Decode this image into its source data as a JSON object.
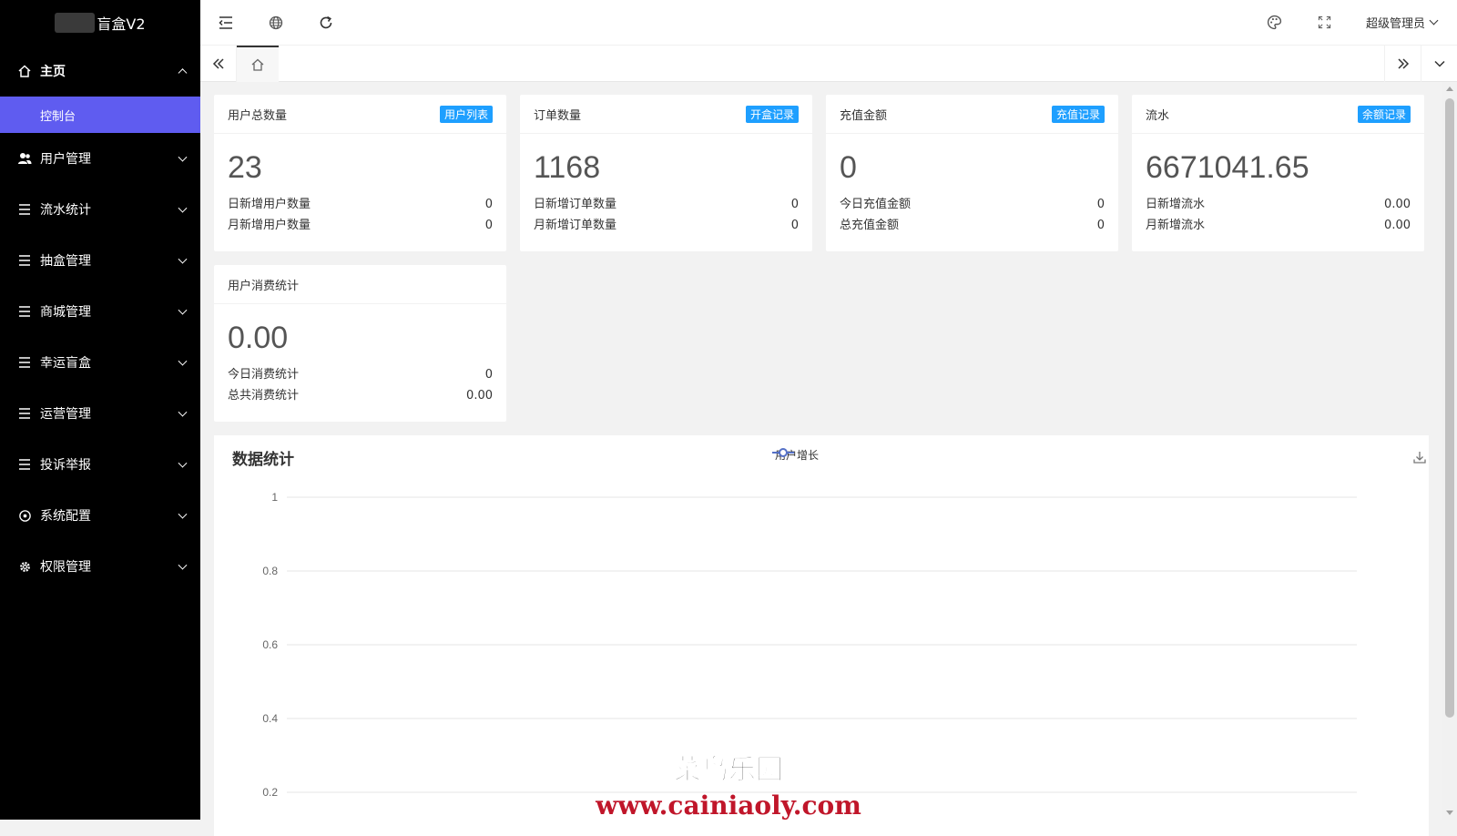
{
  "sidebar": {
    "logo": "盲盒V2",
    "main": {
      "label": "主页",
      "icon": "home-icon"
    },
    "active_sub": {
      "label": "控制台"
    },
    "items": [
      {
        "label": "用户管理",
        "icon": "users-icon"
      },
      {
        "label": "流水统计",
        "icon": "list-icon"
      },
      {
        "label": "抽盒管理",
        "icon": "list-icon"
      },
      {
        "label": "商城管理",
        "icon": "list-icon"
      },
      {
        "label": "幸运盲盒",
        "icon": "list-icon"
      },
      {
        "label": "运营管理",
        "icon": "list-icon"
      },
      {
        "label": "投诉举报",
        "icon": "list-icon"
      },
      {
        "label": "系统配置",
        "icon": "config-icon"
      },
      {
        "label": "权限管理",
        "icon": "gear-icon"
      }
    ],
    "accent": "#5f5cf0"
  },
  "header": {
    "user": "超级管理员"
  },
  "cards": [
    {
      "title": "用户总数量",
      "badge": "用户列表",
      "value": "23",
      "rows": [
        {
          "label": "日新增用户数量",
          "value": "0"
        },
        {
          "label": "月新增用户数量",
          "value": "0"
        }
      ]
    },
    {
      "title": "订单数量",
      "badge": "开盒记录",
      "value": "1168",
      "rows": [
        {
          "label": "日新增订单数量",
          "value": "0"
        },
        {
          "label": "月新增订单数量",
          "value": "0"
        }
      ]
    },
    {
      "title": "充值金额",
      "badge": "充值记录",
      "value": "0",
      "rows": [
        {
          "label": "今日充值金额",
          "value": "0"
        },
        {
          "label": "总充值金额",
          "value": "0"
        }
      ]
    },
    {
      "title": "流水",
      "badge": "余额记录",
      "value": "6671041.65",
      "rows": [
        {
          "label": "日新增流水",
          "value": "0.00"
        },
        {
          "label": "月新增流水",
          "value": "0.00"
        }
      ]
    },
    {
      "title": "用户消费统计",
      "value": "0.00",
      "rows": [
        {
          "label": "今日消费统计",
          "value": "0"
        },
        {
          "label": "总共消费统计",
          "value": "0.00"
        }
      ]
    }
  ],
  "chart": {
    "title": "数据统计",
    "legend": "用户增长",
    "series_color": "#5470c6"
  },
  "chart_data": {
    "type": "line",
    "title": "数据统计",
    "series": [
      {
        "name": "用户增长",
        "values": []
      }
    ],
    "y_ticks": [
      "1",
      "0.8",
      "0.6",
      "0.4",
      "0.2"
    ],
    "ylim": [
      0,
      1
    ],
    "grid": true,
    "legend_position": "top-center"
  },
  "watermark": {
    "line1": "菜鸟乐园",
    "line2": "www.cainiaoly.com"
  },
  "colors": {
    "badge": "#1e9fff",
    "sidebar_bg": "#000000"
  }
}
